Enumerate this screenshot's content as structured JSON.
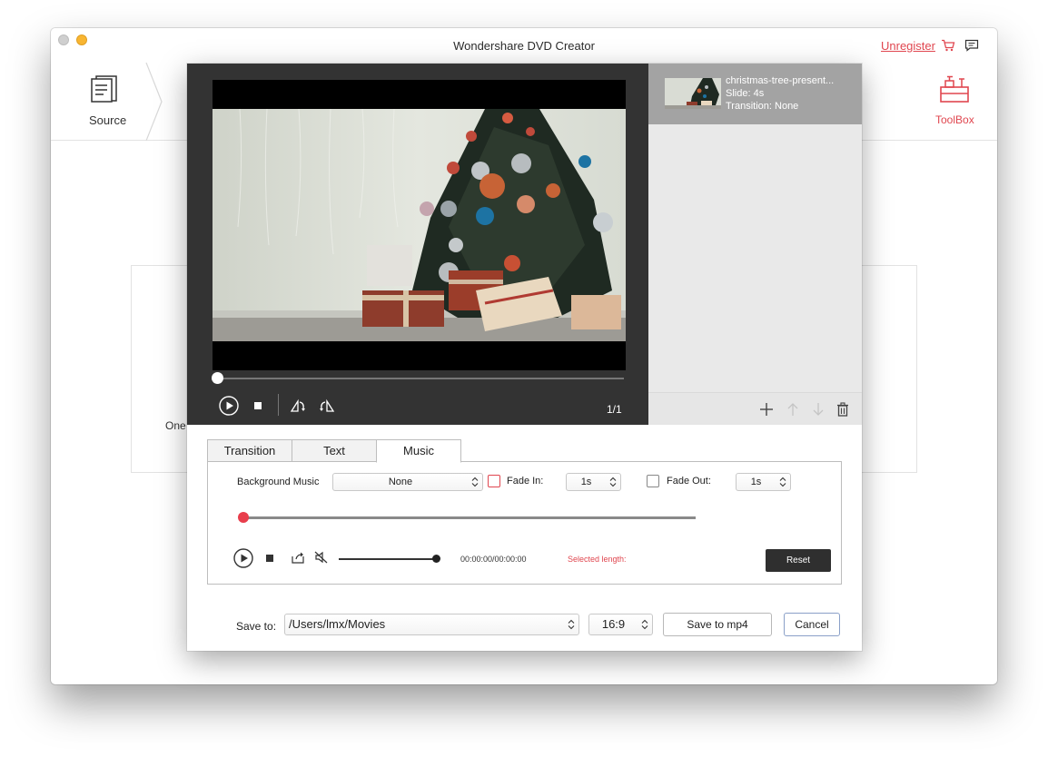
{
  "window": {
    "title": "Wondershare DVD Creator",
    "unregister_label": "Unregister",
    "cart_icon": "cart-icon",
    "message_icon": "message-icon"
  },
  "toolbar": {
    "source_label": "Source",
    "toolbox_label": "ToolBox",
    "accent": "#e0464f"
  },
  "background": {
    "partial_text": "One"
  },
  "preview": {
    "page_counter": "1/1",
    "progress": 0.0
  },
  "slides": [
    {
      "name": "christmas-tree-present...",
      "duration": "Slide: 4s",
      "transition": "Transition: None"
    }
  ],
  "tabs": [
    {
      "label": "Transition",
      "active": false
    },
    {
      "label": "Text",
      "active": false
    },
    {
      "label": "Music",
      "active": true
    }
  ],
  "music": {
    "background_label": "Background Music",
    "background_value": "None",
    "fade_in_label": "Fade In:",
    "fade_in_value": "1s",
    "fade_in_checked": false,
    "fade_out_label": "Fade Out:",
    "fade_out_value": "1s",
    "fade_out_checked": false,
    "position": 0.0,
    "volume": 1.0,
    "time": "00:00:00/00:00:00",
    "selected_length_label": "Selected length:",
    "reset_label": "Reset"
  },
  "save": {
    "label": "Save to:",
    "path": "/Users/lmx/Movies",
    "ratio": "16:9",
    "save_button": "Save to mp4",
    "cancel_button": "Cancel"
  }
}
